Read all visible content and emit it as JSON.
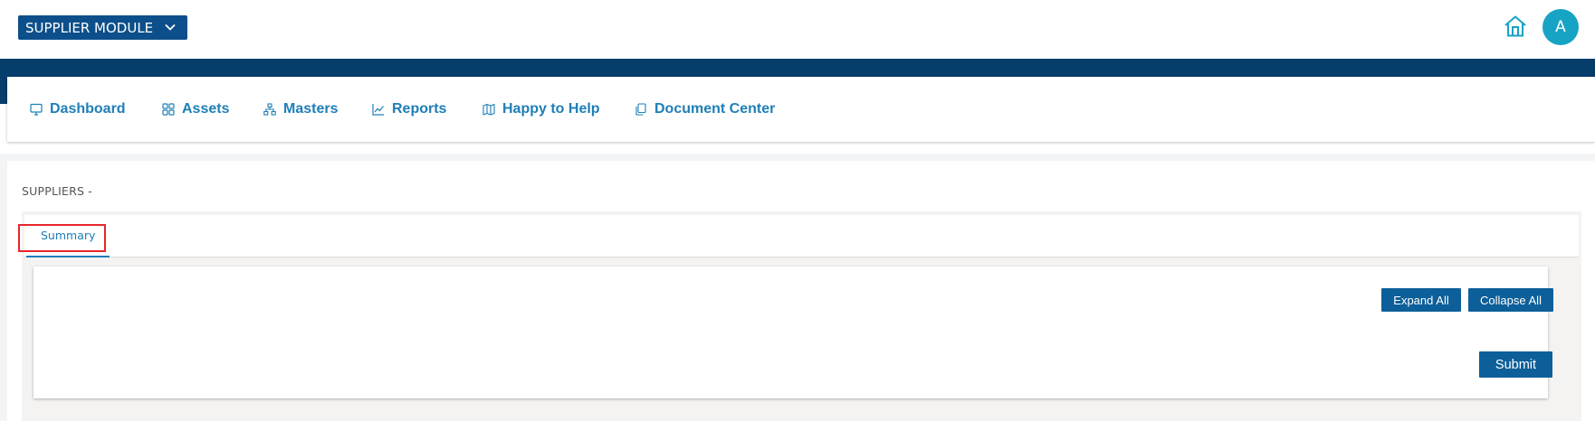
{
  "header": {
    "module_selector": {
      "value": "SUPPLIER MODULE",
      "icon": "chevron-down-icon"
    },
    "home_icon": "home-icon",
    "avatar_initial": "A"
  },
  "nav": {
    "items": [
      {
        "label": "Dashboard",
        "icon": "monitor-icon"
      },
      {
        "label": "Assets",
        "icon": "grid-icon"
      },
      {
        "label": "Masters",
        "icon": "sitemap-icon"
      },
      {
        "label": "Reports",
        "icon": "line-chart-icon"
      },
      {
        "label": "Happy to Help",
        "icon": "map-icon"
      },
      {
        "label": "Document Center",
        "icon": "copy-icon"
      }
    ]
  },
  "page": {
    "title": "SUPPLIERS -",
    "tabs": [
      {
        "label": "Summary",
        "active": true
      }
    ]
  },
  "actions": {
    "expand_all": "Expand All",
    "collapse_all": "Collapse All",
    "submit": "Submit"
  },
  "colors": {
    "primary_dark": "#073d6b",
    "button": "#0d5f99",
    "link": "#1e7fb8",
    "avatar": "#17a3c4",
    "highlight": "#e8262b"
  }
}
